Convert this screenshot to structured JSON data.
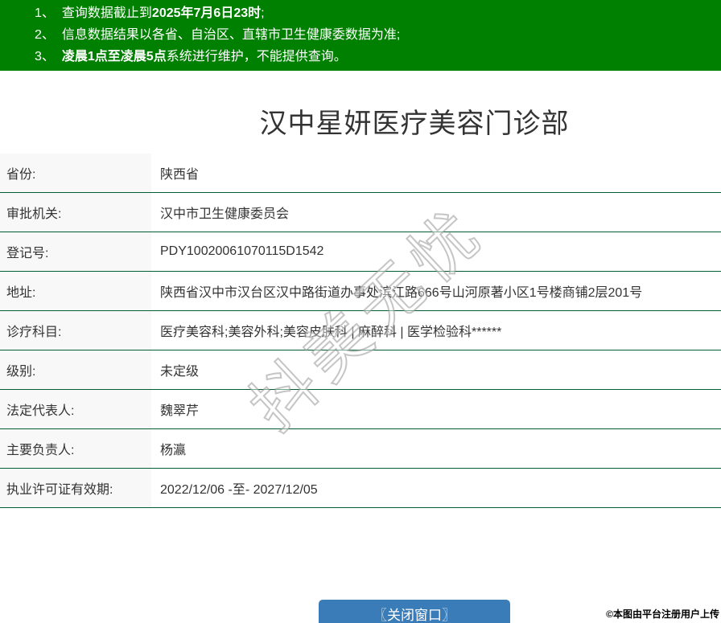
{
  "notices": [
    {
      "num": "1、",
      "pre": "查询数据截止到",
      "bold": "2025年7月6日23时",
      "post": ";"
    },
    {
      "num": "2、",
      "pre": "信息数据结果以各省、自治区、直辖市卫生健康委数据为准;",
      "bold": "",
      "post": ""
    },
    {
      "num": "3、",
      "pre": "",
      "bold": "凌晨1点至凌晨5点",
      "post": "系统进行维护，不能提供查询。"
    }
  ],
  "title": "汉中星妍医疗美容门诊部",
  "table": {
    "rows": [
      {
        "label": "省份:",
        "value": "陕西省"
      },
      {
        "label": "审批机关:",
        "value": "汉中市卫生健康委员会"
      },
      {
        "label": "登记号:",
        "value": "PDY10020061070115D1542"
      },
      {
        "label": "地址:",
        "value": "陕西省汉中市汉台区汉中路街道办事处滨江路666号山河原著小区1号楼商铺2层201号"
      },
      {
        "label": "诊疗科目:",
        "value": "医疗美容科;美容外科;美容皮肤科 | 麻醉科 | 医学检验科******"
      },
      {
        "label": "级别:",
        "value": "未定级"
      },
      {
        "label": "法定代表人:",
        "value": "魏翠芹"
      },
      {
        "label": "主要负责人:",
        "value": "杨瀛"
      },
      {
        "label": "执业许可证有效期:",
        "value": "2022/12/06 -至- 2027/12/05"
      }
    ]
  },
  "watermark": "抖美无忧",
  "close_button_label": "〖关闭窗口〗",
  "footer_credit": "©本图由平台注册用户上传",
  "colors": {
    "header_bg": "#008000",
    "divider": "#005e33",
    "label_bg": "#f8f8f8",
    "button_bg": "#3a7cb8"
  }
}
